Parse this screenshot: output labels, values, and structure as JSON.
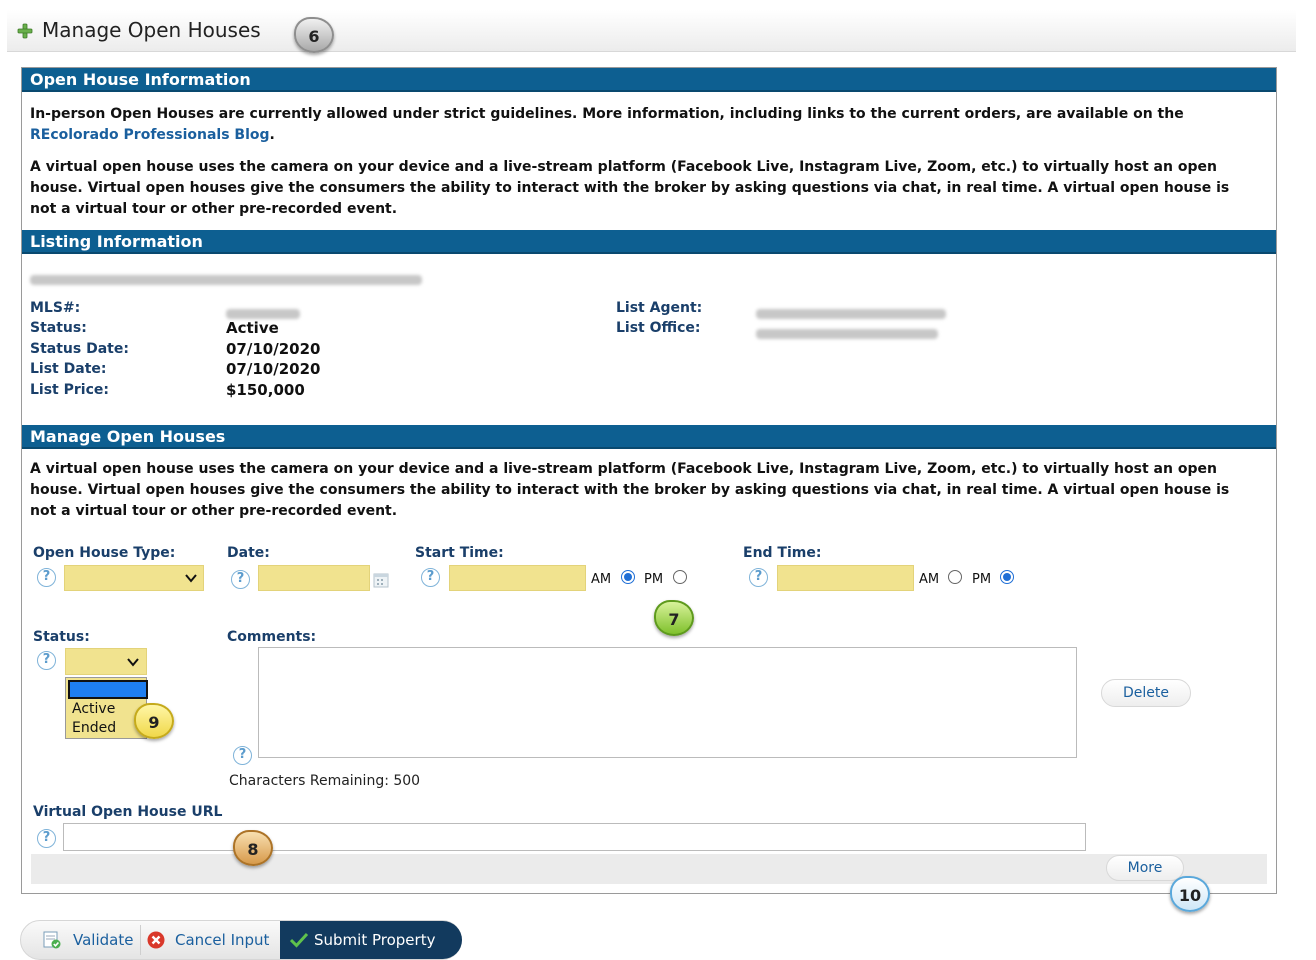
{
  "page": {
    "title": "Manage Open Houses"
  },
  "callouts": [
    "6",
    "7",
    "8",
    "9",
    "10"
  ],
  "open_house_info": {
    "header": "Open House Information",
    "para1_text": "In-person Open Houses are currently allowed under strict guidelines. More information, including links to the current orders, are available on the",
    "para1_link": "REcolorado Professionals Blog",
    "para1_end": ".",
    "para2": "A virtual open house uses the camera on your device and a live-stream platform (Facebook Live, Instagram Live, Zoom, etc.) to virtually host an open house. Virtual open houses give the consumers the ability to interact with the broker by asking questions via chat, in real time. A virtual open house is not a virtual tour or other pre-recorded event."
  },
  "listing_info": {
    "header": "Listing Information",
    "labels": {
      "mls": "MLS#:",
      "status": "Status:",
      "status_date": "Status Date:",
      "list_date": "List Date:",
      "list_price": "List Price:",
      "list_agent": "List Agent:",
      "list_office": "List Office:"
    },
    "values": {
      "status": "Active",
      "status_date": "07/10/2020",
      "list_date": "07/10/2020",
      "list_price": "$150,000"
    }
  },
  "manage": {
    "header": "Manage Open Houses",
    "para": "A virtual open house uses the camera on your device and a live-stream platform (Facebook Live, Instagram Live, Zoom, etc.) to virtually host an open house. Virtual open houses give the consumers the ability to interact with the broker by asking questions via chat, in real time. A virtual open house is not a virtual tour or other pre-recorded event.",
    "labels": {
      "type": "Open House Type:",
      "date": "Date:",
      "start_time": "Start Time:",
      "end_time": "End Time:",
      "status": "Status:",
      "comments": "Comments:",
      "url": "Virtual Open House URL"
    },
    "am": "AM",
    "pm": "PM",
    "status_options": [
      "Active",
      "Ended"
    ],
    "chars_remaining": "Characters Remaining: 500",
    "delete_button": "Delete",
    "more_button": "More",
    "help_glyph": "?"
  },
  "actions": {
    "validate": "Validate",
    "cancel": "Cancel Input",
    "submit": "Submit Property"
  },
  "colors": {
    "header_bg": "#0d5f91",
    "field_yellow": "#f1e38f",
    "link": "#1a5f9e",
    "submit_bg": "#123a5e"
  }
}
